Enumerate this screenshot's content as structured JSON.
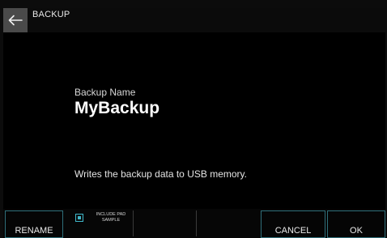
{
  "header": {
    "title": "BACKUP"
  },
  "main": {
    "name_label": "Backup Name",
    "name_value": "MyBackup",
    "description": "Writes the backup data to USB memory."
  },
  "footer": {
    "rename_label": "RENAME",
    "include_pad_label": "INCLUDE PAD SAMPLE",
    "include_pad_checked": true,
    "cancel_label": "CANCEL",
    "ok_label": "OK"
  },
  "icons": {
    "back": "left-arrow-icon"
  },
  "colors": {
    "accent": "#3fb7c9",
    "background": "#000000"
  }
}
